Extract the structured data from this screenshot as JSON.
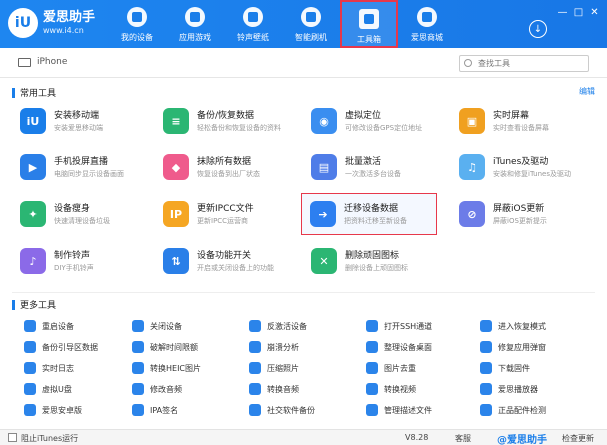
{
  "app": {
    "logo_glyph": "iU",
    "name": "爱思助手",
    "url": "www.i4.cn"
  },
  "nav": [
    {
      "label": "我的设备",
      "icon": "apple-icon"
    },
    {
      "label": "应用游戏",
      "icon": "app-store-icon"
    },
    {
      "label": "铃声壁纸",
      "icon": "music-icon"
    },
    {
      "label": "智能刷机",
      "icon": "flash-icon"
    },
    {
      "label": "工具箱",
      "icon": "toolbox-icon",
      "active": true
    },
    {
      "label": "爱思商城",
      "icon": "shop-icon"
    }
  ],
  "window": {
    "download_glyph": "↓",
    "minimize": "—",
    "maximize": "□",
    "close": "✕"
  },
  "device": {
    "name": "iPhone"
  },
  "search": {
    "placeholder": "查找工具"
  },
  "common_tools": {
    "title": "常用工具",
    "edit_label": "编辑",
    "items": [
      {
        "name": "安装移动端",
        "desc": "安装爱思移动端",
        "icon": "install-icon",
        "color": "#1a7ee9",
        "glyph": "iU"
      },
      {
        "name": "备份/恢复数据",
        "desc": "轻松备份和恢复设备的资料",
        "icon": "backup-icon",
        "color": "#2bb673",
        "glyph": "≡"
      },
      {
        "name": "虚拟定位",
        "desc": "可修改设备GPS定位地址",
        "icon": "location-icon",
        "color": "#3a8ef0",
        "glyph": "◉"
      },
      {
        "name": "实时屏幕",
        "desc": "实时查看设备屏幕",
        "icon": "screen-icon",
        "color": "#f0a020",
        "glyph": "▣"
      },
      {
        "name": "手机投屏直播",
        "desc": "电脑同步显示设备画面",
        "icon": "cast-icon",
        "color": "#2a7fe8",
        "glyph": "▶"
      },
      {
        "name": "抹除所有数据",
        "desc": "恢复设备到出厂状态",
        "icon": "erase-icon",
        "color": "#ef5b8c",
        "glyph": "◆"
      },
      {
        "name": "批量激活",
        "desc": "一次激活多台设备",
        "icon": "batch-icon",
        "color": "#4f7de8",
        "glyph": "▤"
      },
      {
        "name": "iTunes及驱动",
        "desc": "安装和修复iTunes及驱动",
        "icon": "itunes-icon",
        "color": "#5ab0f0",
        "glyph": "♫"
      },
      {
        "name": "设备瘦身",
        "desc": "快速清理设备垃圾",
        "icon": "clean-icon",
        "color": "#2bb673",
        "glyph": "✦"
      },
      {
        "name": "更新IPCC文件",
        "desc": "更新IPCC运营商",
        "icon": "ipcc-icon",
        "color": "#f5a623",
        "glyph": "IP"
      },
      {
        "name": "迁移设备数据",
        "desc": "把资料迁移至新设备",
        "icon": "migrate-icon",
        "color": "#2d7ff0",
        "glyph": "➔",
        "highlight": true
      },
      {
        "name": "屏蔽iOS更新",
        "desc": "屏蔽iOS更新提示",
        "icon": "block-update-icon",
        "color": "#6c7ce8",
        "glyph": "⊘"
      },
      {
        "name": "制作铃声",
        "desc": "DIY手机铃声",
        "icon": "ringtone-icon",
        "color": "#8b6ae8",
        "glyph": "♪"
      },
      {
        "name": "设备功能开关",
        "desc": "开启或关闭设备上的功能",
        "icon": "toggle-icon",
        "color": "#2a7fe8",
        "glyph": "⇅"
      },
      {
        "name": "删除顽固图标",
        "desc": "删除设备上顽固图标",
        "icon": "trash-icon",
        "color": "#2bb673",
        "glyph": "✕"
      }
    ]
  },
  "more_tools": {
    "title": "更多工具",
    "items": [
      {
        "label": "重启设备",
        "icon": "restart-icon"
      },
      {
        "label": "关闭设备",
        "icon": "power-icon"
      },
      {
        "label": "反激活设备",
        "icon": "deactivate-icon"
      },
      {
        "label": "打开SSH通道",
        "icon": "ssh-icon"
      },
      {
        "label": "进入恢复模式",
        "icon": "recovery-icon"
      },
      {
        "label": "备份引导区数据",
        "icon": "boot-backup-icon"
      },
      {
        "label": "破解时间限额",
        "icon": "time-limit-icon"
      },
      {
        "label": "崩溃分析",
        "icon": "crash-icon"
      },
      {
        "label": "整理设备桌面",
        "icon": "desktop-icon"
      },
      {
        "label": "修复应用弹窗",
        "icon": "popup-fix-icon"
      },
      {
        "label": "实时日志",
        "icon": "log-icon"
      },
      {
        "label": "转换HEIC图片",
        "icon": "heic-icon"
      },
      {
        "label": "压缩照片",
        "icon": "compress-icon"
      },
      {
        "label": "图片去重",
        "icon": "dedupe-icon"
      },
      {
        "label": "下载固件",
        "icon": "firmware-icon"
      },
      {
        "label": "虚拟U盘",
        "icon": "usb-icon"
      },
      {
        "label": "修改音频",
        "icon": "audio-icon"
      },
      {
        "label": "转换音频",
        "icon": "convert-audio-icon"
      },
      {
        "label": "转换视频",
        "icon": "convert-video-icon"
      },
      {
        "label": "爱思播放器",
        "icon": "player-icon"
      },
      {
        "label": "爱思安卓版",
        "icon": "android-icon"
      },
      {
        "label": "IPA签名",
        "icon": "ipa-icon"
      },
      {
        "label": "社交软件备份",
        "icon": "social-icon"
      },
      {
        "label": "管理描述文件",
        "icon": "profile-icon"
      },
      {
        "label": "正品配件检测",
        "icon": "accessory-icon"
      }
    ]
  },
  "footer": {
    "itunes_label": "阻止iTunes运行",
    "version": "V8.28",
    "feedback": "客服",
    "watermark": "@爱思助手",
    "update": "检查更新"
  }
}
